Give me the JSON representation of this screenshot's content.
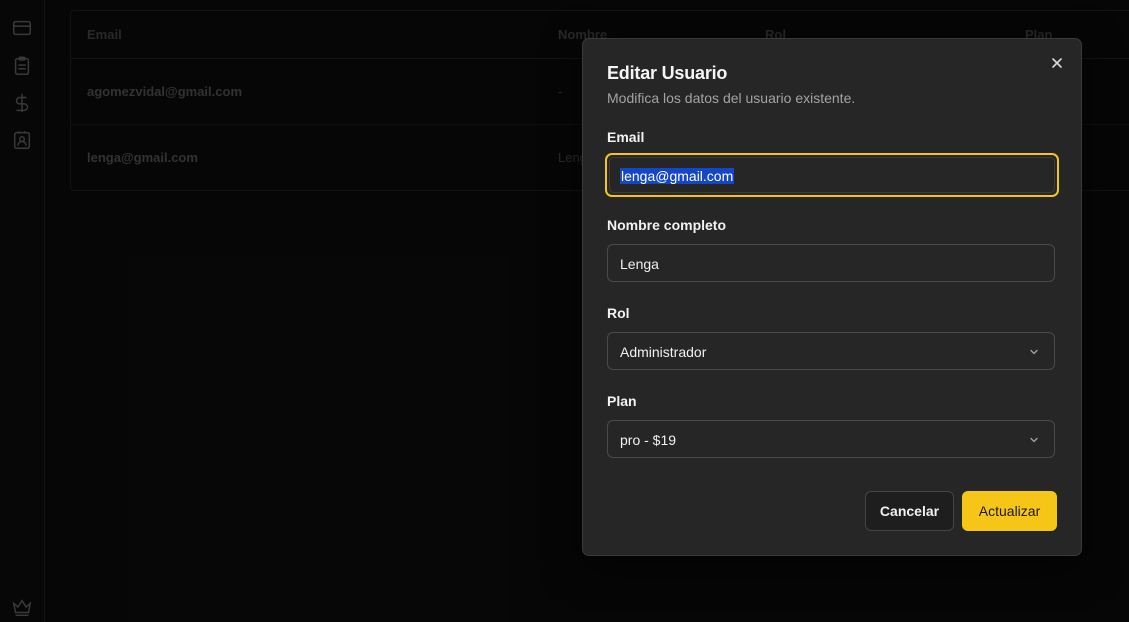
{
  "table": {
    "headers": [
      "Email",
      "Nombre",
      "Rol",
      "Plan"
    ],
    "rows": [
      {
        "email": "agomezvidal@gmail.com",
        "name": "-"
      },
      {
        "email": "lenga@gmail.com",
        "name": "Lenga"
      }
    ]
  },
  "sidebar": {
    "icons": [
      "card-icon",
      "clipboard-icon",
      "dollar-icon",
      "contact-badge-icon",
      "crown-icon"
    ]
  },
  "dialog": {
    "title": "Editar Usuario",
    "subtitle": "Modifica los datos del usuario existente.",
    "email": {
      "label": "Email",
      "value": "lenga@gmail.com"
    },
    "name": {
      "label": "Nombre completo",
      "value": "Lenga"
    },
    "role": {
      "label": "Rol",
      "value": "Administrador"
    },
    "plan": {
      "label": "Plan",
      "value": "pro - $19"
    },
    "cancel_label": "Cancelar",
    "submit_label": "Actualizar"
  },
  "colors": {
    "accent": "#f5c518",
    "dialog_bg": "#262626",
    "page_bg": "#0a0a0a",
    "selection": "#1446c8"
  }
}
